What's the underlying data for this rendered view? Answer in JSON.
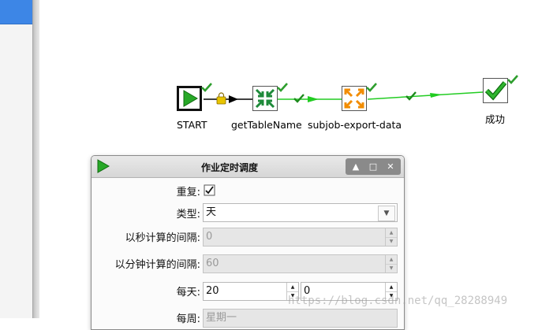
{
  "canvas": {
    "steps": [
      {
        "id": "start",
        "label": "START",
        "icon": "start-arrow-icon",
        "status": "success"
      },
      {
        "id": "getTableName",
        "label": "getTableName",
        "icon": "collapse-arrows-icon",
        "status": "success"
      },
      {
        "id": "subjob",
        "label": "subjob-export-data",
        "icon": "expand-arrows-icon",
        "status": "success"
      },
      {
        "id": "success",
        "label": "成功",
        "icon": "success-check-icon",
        "status": "success"
      }
    ],
    "colors": {
      "hop": "#22cc22",
      "check": "#2e9e2e",
      "orange": "#f28c00"
    }
  },
  "dialog": {
    "title": "作业定时调度",
    "fields": {
      "repeat_label": "重复:",
      "type_label": "类型:",
      "type_value": "天",
      "seconds_label": "以秒计算的间隔:",
      "seconds_value": "0",
      "minutes_label": "以分钟计算的间隔:",
      "minutes_value": "60",
      "daily_label": "每天:",
      "daily_hour": "20",
      "daily_minute": "0",
      "weekly_label": "每周:",
      "weekly_value": "星期一"
    }
  },
  "watermark": "https://blog.csdn.net/qq_28288949"
}
